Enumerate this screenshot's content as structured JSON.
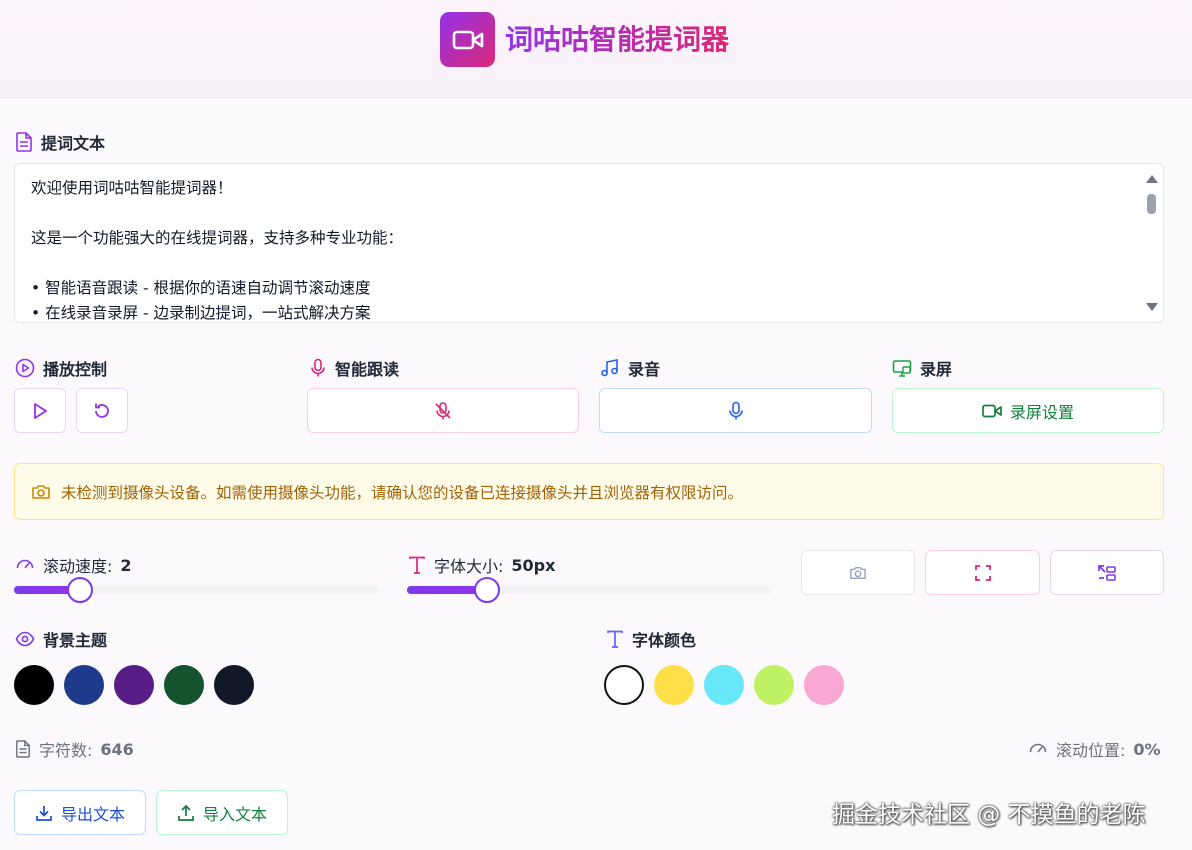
{
  "app": {
    "title": "词咕咕智能提词器"
  },
  "script": {
    "label": "提词文本",
    "lines": [
      "欢迎使用词咕咕智能提词器！",
      "",
      "这是一个功能强大的在线提词器，支持多种专业功能：",
      "",
      "• 智能语音跟读 - 根据你的语速自动调节滚动速度",
      "• 在线录音录屏 - 边录制边提词，一站式解决方案"
    ]
  },
  "controls": {
    "playback_label": "播放控制",
    "smart_follow_label": "智能跟读",
    "record_label": "录音",
    "screen_record_label": "录屏",
    "screen_settings_button": "录屏设置"
  },
  "alert": {
    "message": "未检测到摄像头设备。如需使用摄像头功能，请确认您的设备已连接摄像头并且浏览器有权限访问。"
  },
  "speed": {
    "label": "滚动速度:",
    "value": "2",
    "fraction": 0.18
  },
  "font_size": {
    "label": "字体大小:",
    "value": "50px",
    "fraction": 0.22
  },
  "background_theme": {
    "label": "背景主题",
    "colors": [
      "#000000",
      "#1e3a8a",
      "#581c87",
      "#14532d",
      "#111827"
    ]
  },
  "font_color": {
    "label": "字体颜色",
    "colors": [
      "#ffffff",
      "#fde047",
      "#67e8f9",
      "#bef264",
      "#f9a8d4"
    ],
    "selected": 0
  },
  "stats": {
    "char_count_label": "字符数:",
    "char_count": "646",
    "scroll_pos_label": "滚动位置:",
    "scroll_pos": "0%"
  },
  "actions": {
    "export_label": "导出文本",
    "import_label": "导入文本"
  },
  "watermark": "掘金技术社区 @ 不摸鱼的老陈",
  "theme": {
    "purple": "#9333ea",
    "pink": "#db2777",
    "blue": "#2563eb",
    "green": "#15803d",
    "amber": "#a16207"
  }
}
